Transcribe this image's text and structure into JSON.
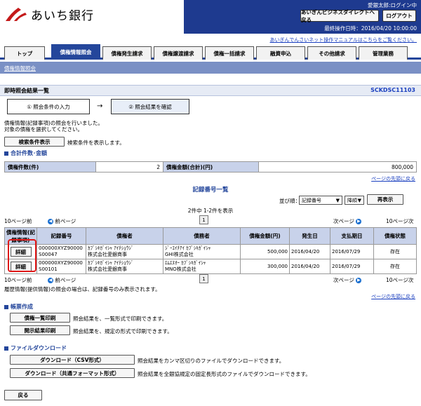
{
  "brand": {
    "name": "あいち銀行"
  },
  "header": {
    "user": "愛銀太郎:ログイン中",
    "buttons": [
      "あいぎんビジネスダイレクトへ戻る",
      "ログアウト"
    ],
    "last_operation": "最終操作日時：2016/04/20 10:00:00",
    "manual_link": "あいぎんでんさいネット操作マニュアルはこちらをご覧ください。"
  },
  "tabs": [
    "トップ",
    "債権情報照会",
    "債権発生請求",
    "債権譲渡請求",
    "債権一括請求",
    "融資申込",
    "その他請求",
    "管理業務"
  ],
  "subnav": {
    "link": "債権情報照会"
  },
  "page": {
    "title": "即時照会結果一覧",
    "screen_id": "SCKDSC11103"
  },
  "steps": [
    "① 照会条件の入力",
    "→",
    "② 照会結果を確認"
  ],
  "intro": [
    "債権情報(記録事項)の照会を行いました。",
    "対象の債権を選択してください。"
  ],
  "search_cond": {
    "button": "検索条件表示",
    "text": "検索条件を表示します。"
  },
  "summary": {
    "heading": "合計件数･金額",
    "count_label": "債権件数(件)",
    "count_value": "2",
    "amount_label": "債権金額(合計)(円)",
    "amount_value": "800,000"
  },
  "page_top_link": "ページの先頭に戻る",
  "list": {
    "title": "記録番号一覧",
    "sort_label": "並び順：",
    "sort_field": "記録番号",
    "sort_order": "降順",
    "reorder_button": "再表示",
    "count_text": "2件中 1-2件を表示",
    "prev10": "10ページ前",
    "prev": "前ページ",
    "page": "1",
    "next": "次ページ",
    "next10": "10ページ次",
    "headers": [
      "債権情報(記録事項)",
      "記録番号",
      "債権者",
      "債務者",
      "債権金額(円)",
      "発生日",
      "支払期日",
      "債権状態"
    ],
    "rows": [
      {
        "action": "詳細",
        "record": [
          "000000XYZ90000",
          "S00047"
        ],
        "creditor": [
          "ｶﾌﾞｼｷｶﾞｲｼｬ ｱｲﾁｼｮｳｼﾞ",
          "株式会社愛銀商事"
        ],
        "debtor": [
          "ｼﾞｰｴｲﾁｱｲ ｶﾌﾞｼｷｶﾞｲｼｬ",
          "GHI株式会社"
        ],
        "amount": "500,000",
        "issue": "2016/04/20",
        "due": "2016/07/29",
        "status": "存在"
      },
      {
        "action": "詳細",
        "record": [
          "000000XYZ90000",
          "S00101"
        ],
        "creditor": [
          "ｶﾌﾞｼｷｶﾞｲｼｬ ｱｲﾁｼｮｳｼﾞ",
          "株式会社愛銀商事"
        ],
        "debtor": [
          "ｴﾑｴﾇｵｰ ｶﾌﾞｼｷｶﾞｲｼｬ",
          "MNO株式会社"
        ],
        "amount": "300,000",
        "issue": "2016/04/20",
        "due": "2016/07/29",
        "status": "存在"
      }
    ],
    "note": "履歴情報(提供情報)の照会の場合は、記録番号のみ表示されます。"
  },
  "reports": {
    "heading": "帳票作成",
    "items": [
      {
        "button": "債権一覧印刷",
        "text": "照会結果を、一覧形式で印刷できます。"
      },
      {
        "button": "開示結果印刷",
        "text": "照会結果を、規定の形式で印刷できます。"
      }
    ]
  },
  "download": {
    "heading": "ファイルダウンロード",
    "items": [
      {
        "button": "ダウンロード（CSV形式）",
        "text": "照会結果をカンマ区切りのファイルでダウンロードできます。"
      },
      {
        "button": "ダウンロード（共通フォーマット形式）",
        "text": "照会結果を全銀協規定の固定長形式のファイルでダウンロードできます。"
      }
    ]
  },
  "back_button": "戻る",
  "colors": {
    "primary": "#24469b",
    "header_bg": "#1e3a8f",
    "subnav": "#7a90c5",
    "highlight": "#e01818",
    "brand_red": "#c41a1a"
  }
}
